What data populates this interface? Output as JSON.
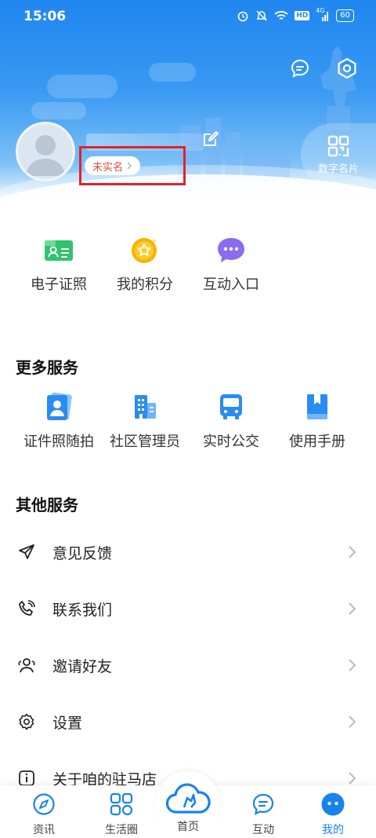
{
  "status_bar": {
    "time": "15:06",
    "network_label": "4G",
    "hd_label": "HD",
    "battery": "60"
  },
  "header": {
    "realname_status": "未实名",
    "namecard_label": "数字名片"
  },
  "quick_actions": [
    {
      "label": "电子证照",
      "icon": "id-card-icon"
    },
    {
      "label": "我的积分",
      "icon": "star-coin-icon"
    },
    {
      "label": "互动入口",
      "icon": "chat-bubble-icon"
    }
  ],
  "more_services": {
    "title": "更多服务",
    "items": [
      {
        "label": "证件照随拍",
        "icon": "id-photo-icon"
      },
      {
        "label": "社区管理员",
        "icon": "building-icon"
      },
      {
        "label": "实时公交",
        "icon": "bus-icon"
      },
      {
        "label": "使用手册",
        "icon": "book-icon"
      }
    ]
  },
  "other_services": {
    "title": "其他服务",
    "items": [
      {
        "label": "意见反馈",
        "icon": "send-icon"
      },
      {
        "label": "联系我们",
        "icon": "phone-icon"
      },
      {
        "label": "邀请好友",
        "icon": "users-icon"
      },
      {
        "label": "设置",
        "icon": "gear-icon"
      },
      {
        "label": "关于咱的驻马店",
        "icon": "info-icon"
      }
    ]
  },
  "bottom_nav": {
    "items": [
      {
        "label": "资讯",
        "icon": "compass-icon"
      },
      {
        "label": "生活圈",
        "icon": "grid-icon"
      },
      {
        "label": "首页",
        "icon": "home-logo-icon"
      },
      {
        "label": "互动",
        "icon": "message-icon"
      },
      {
        "label": "我的",
        "icon": "profile-icon"
      }
    ],
    "active": "我的"
  },
  "colors": {
    "brand_blue": "#1a82ec",
    "highlight_red": "#e3222a",
    "chip_text": "#e04b3a"
  }
}
